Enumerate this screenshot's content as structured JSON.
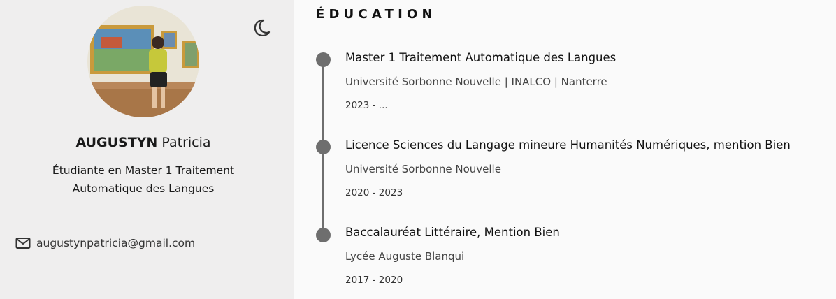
{
  "profile": {
    "last_name": "AUGUSTYN",
    "first_name": "Patricia",
    "subtitle": "Étudiante en Master 1 Traitement Automatique des Langues",
    "email": "augustynpatricia@gmail.com"
  },
  "icons": {
    "theme_toggle": "moon-icon",
    "email": "mail-icon"
  },
  "education": {
    "title": "ÉDUCATION",
    "entries": [
      {
        "title": "Master 1 Traitement Automatique des Langues",
        "school": "Université Sorbonne Nouvelle | INALCO | Nanterre",
        "years": "2023 - ..."
      },
      {
        "title": "Licence Sciences du Langage mineure Humanités Numériques, mention Bien",
        "school": "Université Sorbonne Nouvelle",
        "years": "2020 - 2023"
      },
      {
        "title": "Baccalauréat Littéraire, Mention Bien",
        "school": "Lycée Auguste Blanqui",
        "years": "2017 - 2020"
      }
    ]
  },
  "colors": {
    "sidebar_bg": "#efeeee",
    "main_bg": "#fafafa",
    "timeline": "#6e6e6e"
  }
}
